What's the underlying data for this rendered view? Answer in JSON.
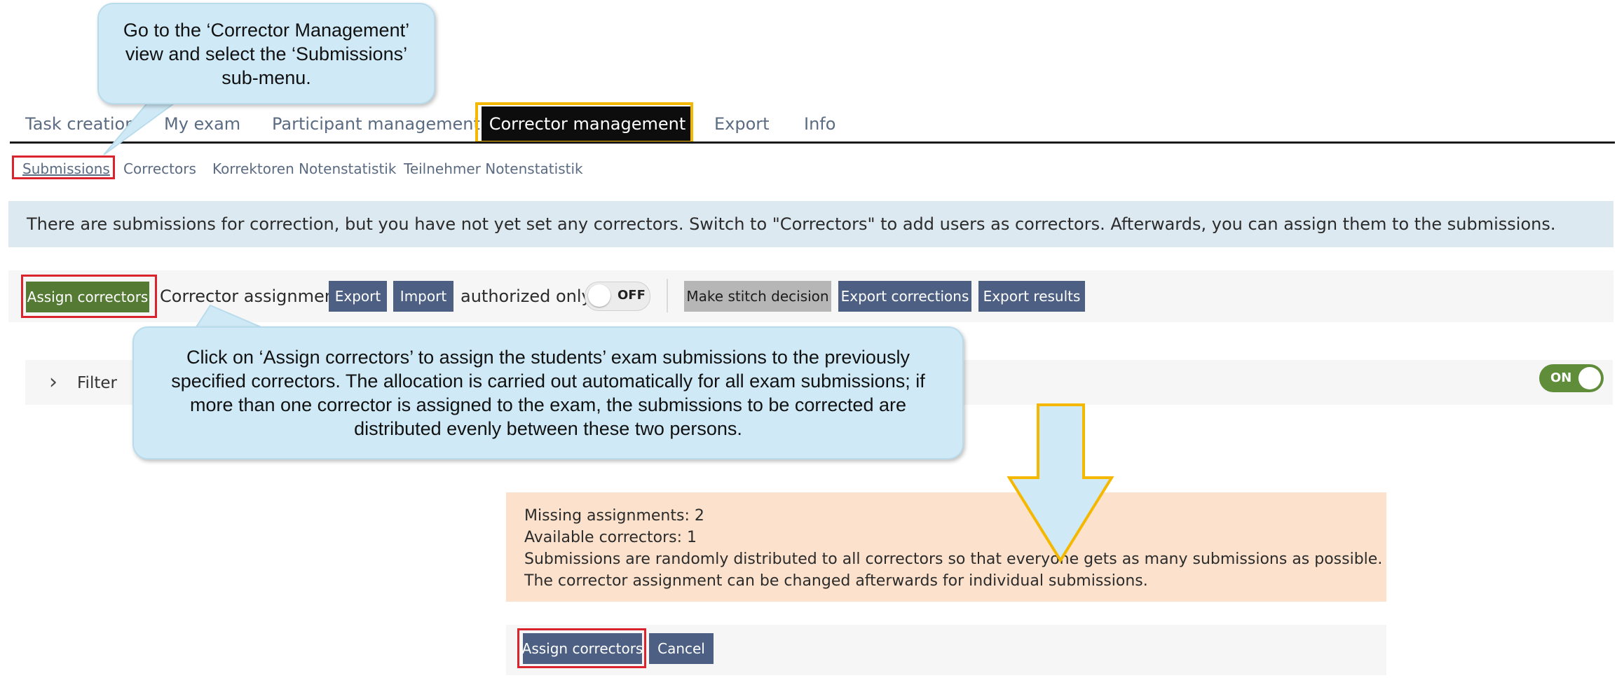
{
  "tabs": [
    {
      "label": "Task creation"
    },
    {
      "label": "My exam"
    },
    {
      "label": "Participant management"
    },
    {
      "label": "Corrector management"
    },
    {
      "label": "Export"
    },
    {
      "label": "Info"
    }
  ],
  "submenu": [
    {
      "label": "Submissions"
    },
    {
      "label": "Correctors"
    },
    {
      "label": "Korrektoren Notenstatistik"
    },
    {
      "label": "Teilnehmer Notenstatistik"
    }
  ],
  "info_message": "There are submissions for correction, but you have not yet set any correctors. Switch to \"Correctors\" to add users as correctors. Afterwards, you can assign them to the submissions.",
  "toolbar": {
    "assign_correctors": "Assign correctors",
    "corrector_assignment_label": "Corrector assignment",
    "export": "Export",
    "import": "Import",
    "authorized_only_label": "authorized only",
    "authorized_only_toggle": "OFF",
    "make_stitch_decision": "Make stitch decision",
    "export_corrections": "Export corrections",
    "export_results": "Export results"
  },
  "filter": {
    "label": "Filter",
    "toggle": "ON"
  },
  "assignment_info": {
    "missing": "Missing assignments: 2",
    "available": "Available correctors: 1",
    "distribution": "Submissions are randomly distributed to all correctors so that everyone gets as many submissions as possible.",
    "changeable": "The corrector assignment can be changed afterwards for individual submissions."
  },
  "dialog": {
    "assign_correctors": "Assign correctors",
    "cancel": "Cancel"
  },
  "callouts": {
    "nav_hint": [
      "Go to the ‘Corrector Management’",
      "view and select the ‘Submissions’",
      "sub-menu."
    ],
    "assign_hint": [
      "Click on ‘Assign correctors’ to assign the students’ exam submissions to the previously",
      "specified correctors. The allocation is carried out automatically for all exam submissions; if",
      "more than one corrector is assigned to the exam, the submissions to be corrected are",
      "distributed evenly between these two persons."
    ]
  },
  "colors": {
    "active_tab_bg": "#0d0d0d",
    "highlight_yellow": "#f5b800",
    "highlight_red": "#d9232d",
    "button_green": "#557a33",
    "button_blue": "#4d6083",
    "info_bar_bg": "#dde9f0",
    "warning_bg": "#fce2cc",
    "callout_bg": "#cfeaf6"
  }
}
